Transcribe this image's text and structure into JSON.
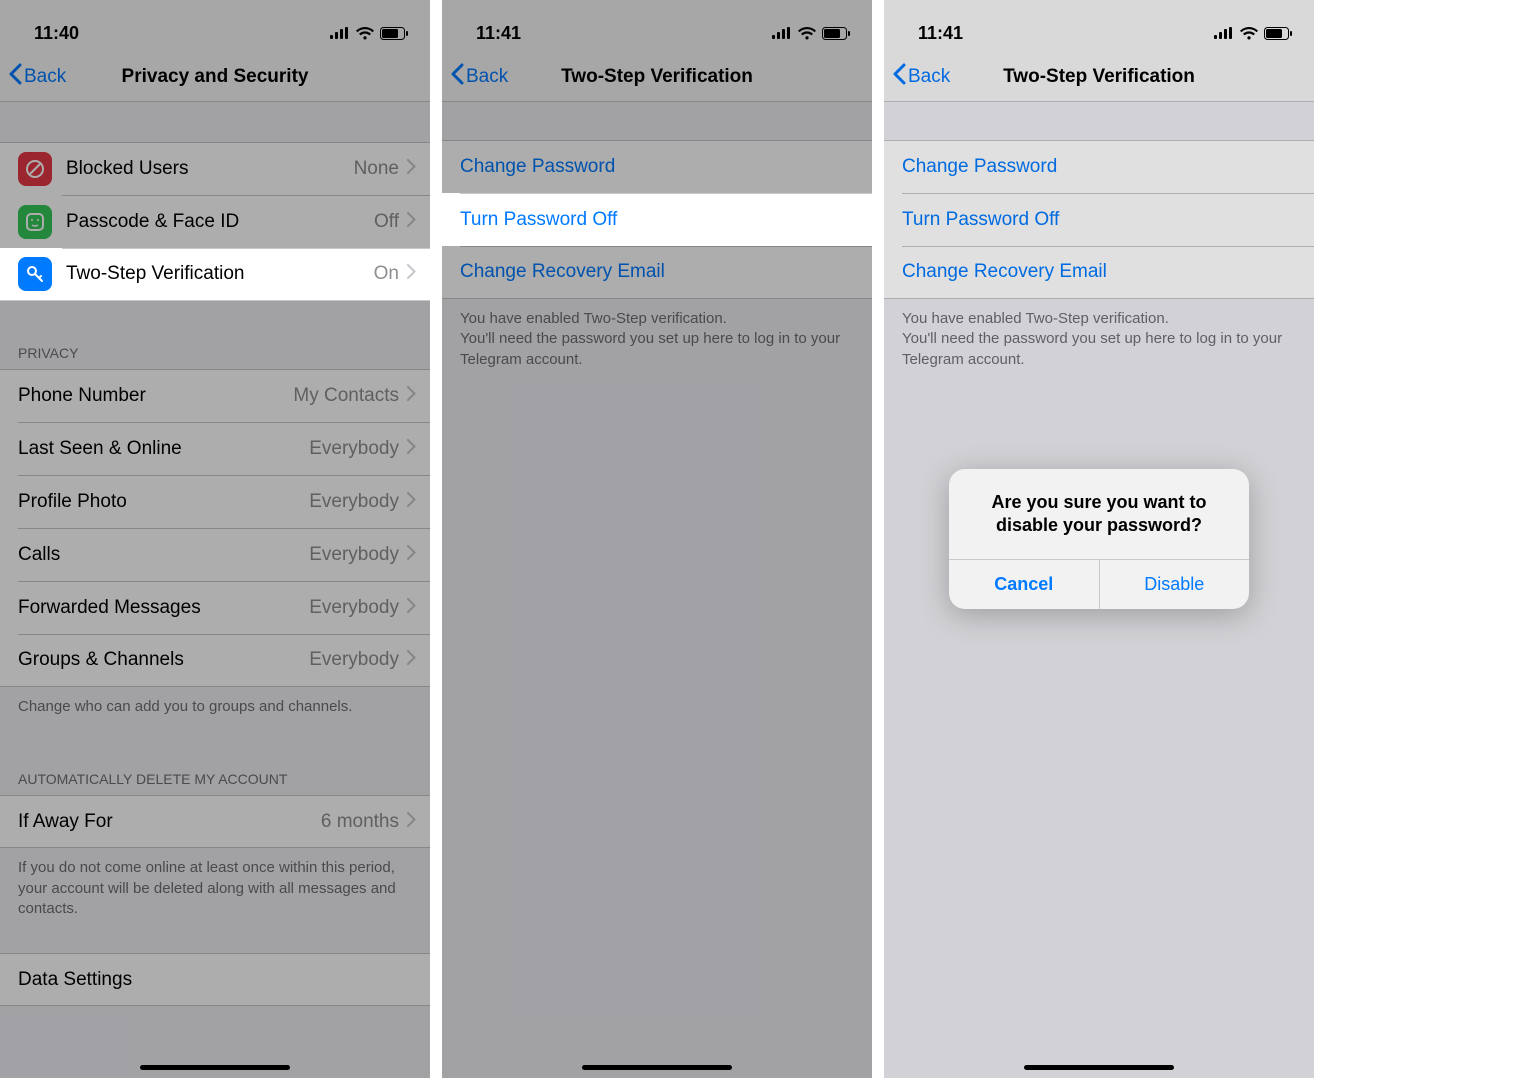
{
  "col1": {
    "status_time": "11:40",
    "back_label": "Back",
    "title": "Privacy and Security",
    "security": {
      "items": [
        {
          "label": "Blocked Users",
          "value": "None",
          "icon": "block-icon",
          "icon_bg": "#e63946",
          "icon_fg": "#ffffff"
        },
        {
          "label": "Passcode & Face ID",
          "value": "Off",
          "icon": "faceid-icon",
          "icon_bg": "#34c759",
          "icon_fg": "#ffffff"
        },
        {
          "label": "Two-Step Verification",
          "value": "On",
          "icon": "key-icon",
          "icon_bg": "#007aff",
          "icon_fg": "#ffffff",
          "highlight": true
        }
      ]
    },
    "privacy": {
      "header": "PRIVACY",
      "items": [
        {
          "label": "Phone Number",
          "value": "My Contacts"
        },
        {
          "label": "Last Seen & Online",
          "value": "Everybody"
        },
        {
          "label": "Profile Photo",
          "value": "Everybody"
        },
        {
          "label": "Calls",
          "value": "Everybody"
        },
        {
          "label": "Forwarded Messages",
          "value": "Everybody"
        },
        {
          "label": "Groups & Channels",
          "value": "Everybody"
        }
      ],
      "footer": "Change who can add you to groups and channels."
    },
    "autodelete": {
      "header": "AUTOMATICALLY DELETE MY ACCOUNT",
      "items": [
        {
          "label": "If Away For",
          "value": "6 months"
        }
      ],
      "footer": "If you do not come online at least once within this period, your account will be deleted along with all messages and contacts."
    },
    "data_settings": {
      "label": "Data Settings"
    }
  },
  "col2": {
    "status_time": "11:41",
    "back_label": "Back",
    "title": "Two-Step Verification",
    "items": [
      {
        "label": "Change Password"
      },
      {
        "label": "Turn Password Off",
        "highlight": true
      },
      {
        "label": "Change Recovery Email"
      }
    ],
    "footer": "You have enabled Two-Step verification.\nYou'll need the password you set up here to log in to your Telegram account."
  },
  "col3": {
    "status_time": "11:41",
    "back_label": "Back",
    "title": "Two-Step Verification",
    "items": [
      {
        "label": "Change Password"
      },
      {
        "label": "Turn Password Off"
      },
      {
        "label": "Change Recovery Email"
      }
    ],
    "footer": "You have enabled Two-Step verification.\nYou'll need the password you set up here to log in to your Telegram account.",
    "alert": {
      "message": "Are you sure you want to disable your password?",
      "cancel": "Cancel",
      "confirm": "Disable"
    }
  }
}
